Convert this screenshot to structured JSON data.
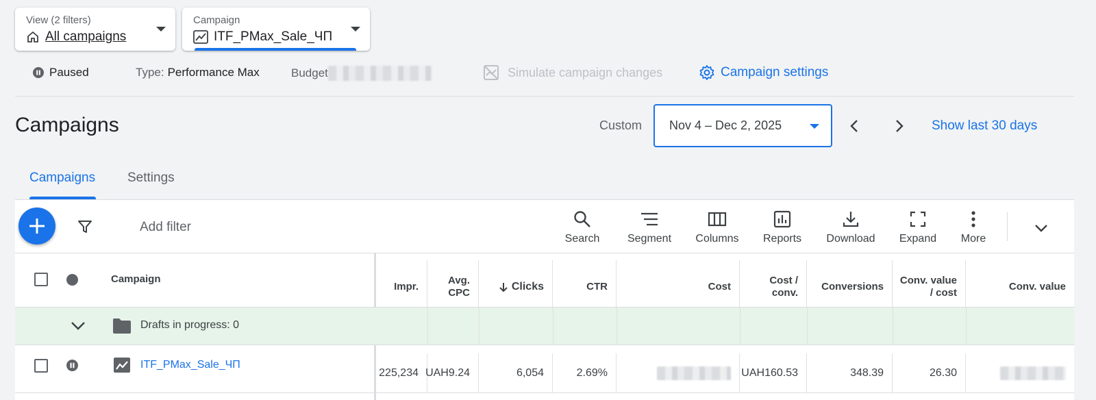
{
  "view_selector": {
    "label": "View (2 filters)",
    "value": "All campaigns"
  },
  "campaign_selector": {
    "label": "Campaign",
    "value": "ITF_PMax_Sale_ЧП"
  },
  "status_bar": {
    "status": "Paused",
    "type_label": "Type:",
    "type_value": "Performance Max",
    "budget_label": "Budget",
    "simulate_label": "Simulate campaign changes",
    "settings_label": "Campaign settings"
  },
  "page_title": "Campaigns",
  "date_range": {
    "mode": "Custom",
    "value": "Nov 4 – Dec 2, 2025",
    "show_last_label": "Show last 30 days"
  },
  "tabs": [
    {
      "label": "Campaigns",
      "active": true
    },
    {
      "label": "Settings",
      "active": false
    }
  ],
  "toolbar": {
    "add_filter_label": "Add filter",
    "buttons": [
      {
        "label": "Search",
        "icon": "search-icon"
      },
      {
        "label": "Segment",
        "icon": "segment-icon"
      },
      {
        "label": "Columns",
        "icon": "columns-icon"
      },
      {
        "label": "Reports",
        "icon": "reports-icon"
      },
      {
        "label": "Download",
        "icon": "download-icon"
      },
      {
        "label": "Expand",
        "icon": "expand-icon"
      },
      {
        "label": "More",
        "icon": "more-vert-icon"
      }
    ]
  },
  "table": {
    "columns": {
      "campaign": "Campaign",
      "impr": "Impr.",
      "avg_cpc_1": "Avg.",
      "avg_cpc_2": "CPC",
      "clicks": "Clicks",
      "ctr": "CTR",
      "cost": "Cost",
      "cost_conv_1": "Cost /",
      "cost_conv_2": "conv.",
      "conversions": "Conversions",
      "conv_value_cost_1": "Conv. value",
      "conv_value_cost_2": "/ cost",
      "conv_value": "Conv. value"
    },
    "drafts_label": "Drafts in progress: 0",
    "rows": [
      {
        "campaign": "ITF_PMax_Sale_ЧП",
        "impr": "225,234",
        "avg_cpc": "UAH9.24",
        "clicks": "6,054",
        "ctr": "2.69%",
        "cost_conv": "UAH160.53",
        "conversions": "348.39",
        "conv_value_cost": "26.30"
      }
    ]
  },
  "colors": {
    "accent": "#1a73e8",
    "drafts_bg": "#e6f4ea",
    "text": "#202124"
  }
}
